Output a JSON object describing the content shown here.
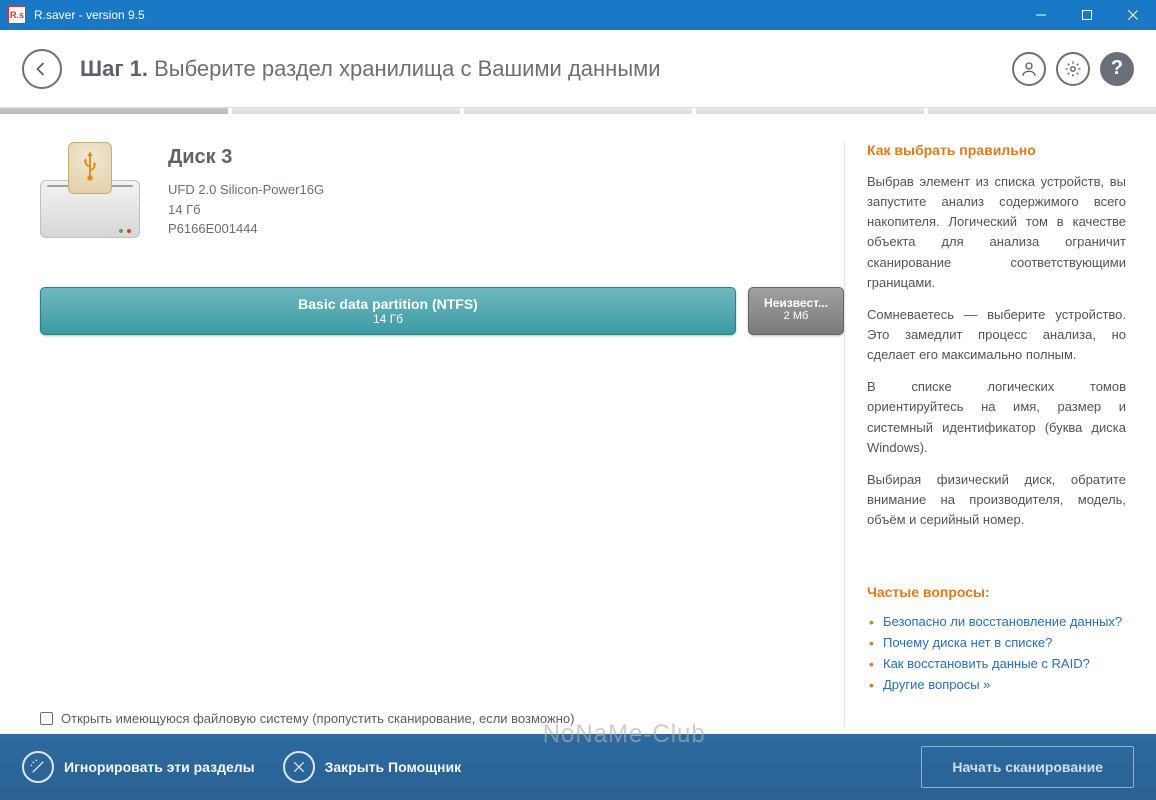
{
  "window": {
    "app_icon_text": "R.s",
    "title": "R.saver - version 9.5"
  },
  "header": {
    "step_label": "Шаг 1.",
    "step_text": "Выберите раздел хранилища с Вашими данными"
  },
  "disk": {
    "title": "Диск 3",
    "model": "UFD 2.0 Silicon-Power16G",
    "size": "14 Гб",
    "serial": "P6166E001444"
  },
  "partitions": {
    "main": {
      "name": "Basic data partition (NTFS)",
      "size": "14 Гб"
    },
    "unknown": {
      "name": "Неизвест...",
      "size": "2 Мб"
    }
  },
  "skip_checkbox_label": "Открыть имеющуюся файловую систему (пропустить сканирование, если возможно)",
  "help": {
    "heading": "Как выбрать правильно",
    "p1": "Выбрав элемент из списка устройств, вы запустите анализ содержимого всего накопителя. Логический том в качестве объекта для анализа ограничит сканирование соответствующими границами.",
    "p2": "Сомневаетесь — выберите устройство. Это замедлит процесс анализа, но сделает его максимально полным.",
    "p3": "В списке логических томов ориентируйтесь на имя, размер и системный идентификатор (буква диска Windows).",
    "p4": "Выбирая физический диск, обратите внимание на производителя, модель, объём и серийный номер.",
    "faq_heading": "Частые вопросы:",
    "faq": [
      "Безопасно ли восстановление данных?",
      "Почему диска нет в списке?",
      "Как восстановить данные с RAID?",
      "Другие вопросы »"
    ]
  },
  "footer": {
    "ignore": "Игнорировать эти разделы",
    "close_helper": "Закрыть Помощник",
    "start": "Начать сканирование"
  },
  "watermark": "NoNaMe-Club"
}
